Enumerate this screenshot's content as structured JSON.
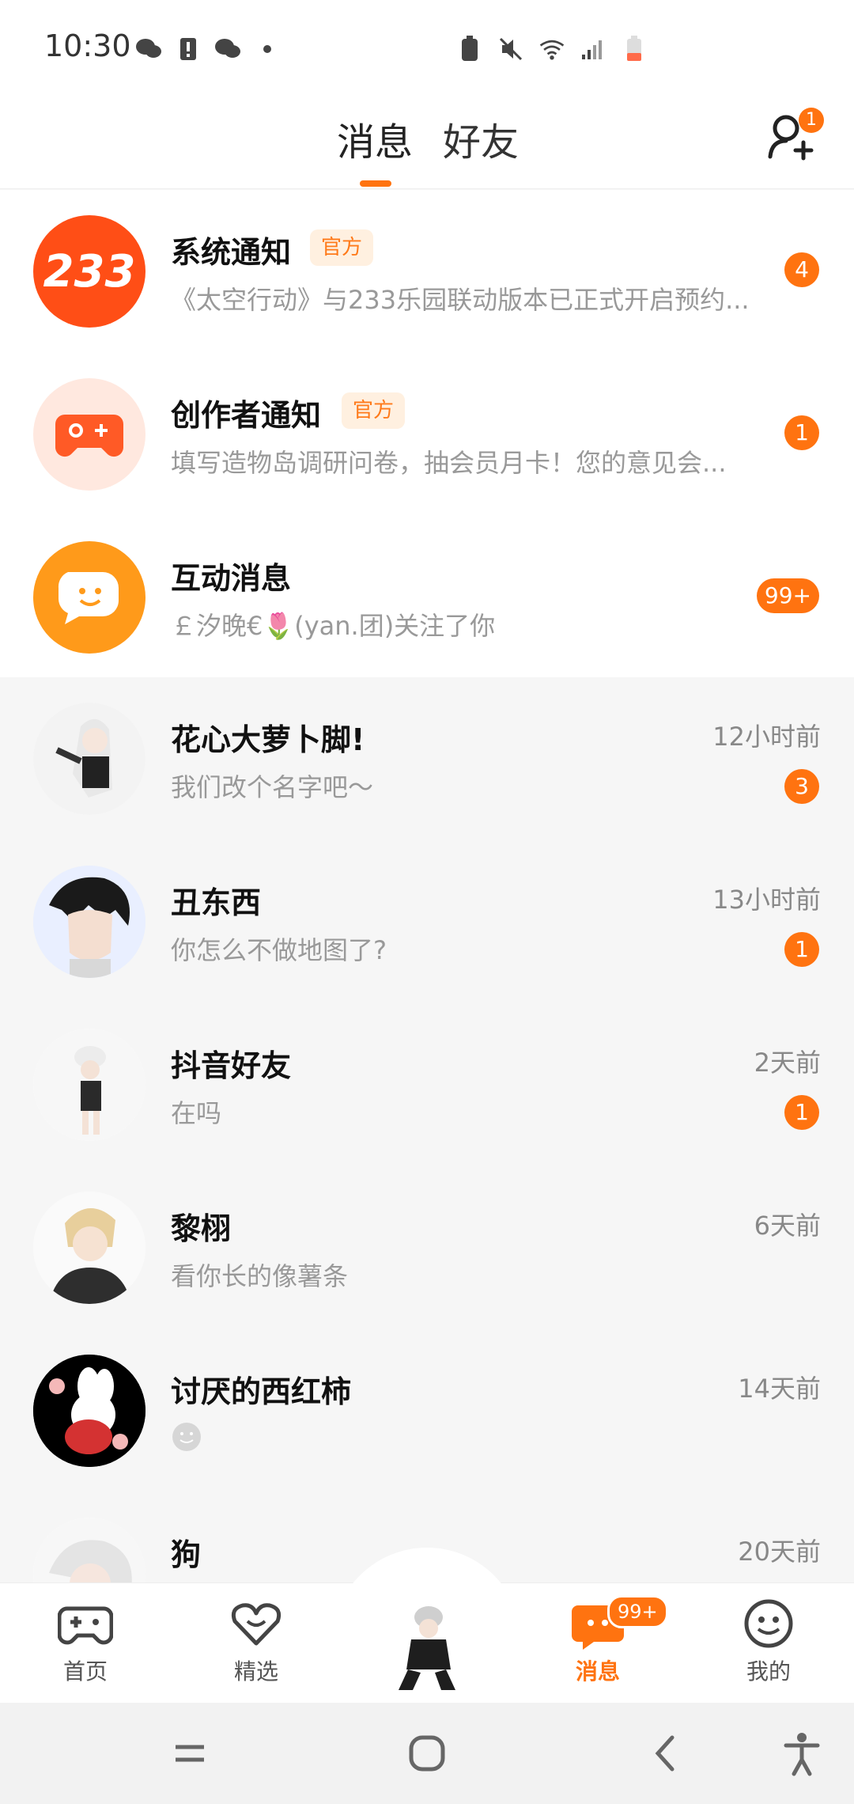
{
  "status_bar": {
    "time": "10:30"
  },
  "header": {
    "tabs": [
      {
        "label": "消息",
        "active": true
      },
      {
        "label": "好友",
        "active": false
      }
    ],
    "add_friend_badge": "1"
  },
  "official_items": [
    {
      "name": "系统通知",
      "tag": "官方",
      "preview": "《太空行动》与233乐园联动版本已正式开启预约...",
      "badge": "4",
      "avatar_text": "233"
    },
    {
      "name": "创作者通知",
      "tag": "官方",
      "preview": "填写造物岛调研问卷，抽会员月卡！您的意见会...",
      "badge": "1"
    },
    {
      "name": "互动消息",
      "tag": "",
      "preview": "￡汐晚€🌷(yan.团)关注了你",
      "badge": "99+"
    }
  ],
  "chats": [
    {
      "name": "花心大萝卜脚!",
      "time": "12小时前",
      "preview": "我们改个名字吧～",
      "badge": "3"
    },
    {
      "name": "丑东西",
      "time": "13小时前",
      "preview": "你怎么不做地图了?",
      "badge": "1"
    },
    {
      "name": "抖音好友",
      "time": "2天前",
      "preview": "在吗",
      "badge": "1"
    },
    {
      "name": "黎栩",
      "time": "6天前",
      "preview": "看你长的像薯条",
      "badge": ""
    },
    {
      "name": "讨厌的西红柿",
      "time": "14天前",
      "preview": "",
      "badge": ""
    },
    {
      "name": "狗",
      "time": "20天前",
      "preview": "",
      "badge": ""
    }
  ],
  "bottom_nav": {
    "items": [
      {
        "label": "首页",
        "icon": "gamepad-icon",
        "active": false
      },
      {
        "label": "精选",
        "icon": "heart-icon",
        "active": false
      },
      {
        "label": "消息",
        "icon": "message-icon",
        "active": true
      },
      {
        "label": "我的",
        "icon": "smile-icon",
        "active": false
      }
    ],
    "message_badge": "99+"
  },
  "colors": {
    "accent": "#ff7310",
    "tag_bg": "#fff0e0",
    "tag_text": "#ff7a1a"
  }
}
